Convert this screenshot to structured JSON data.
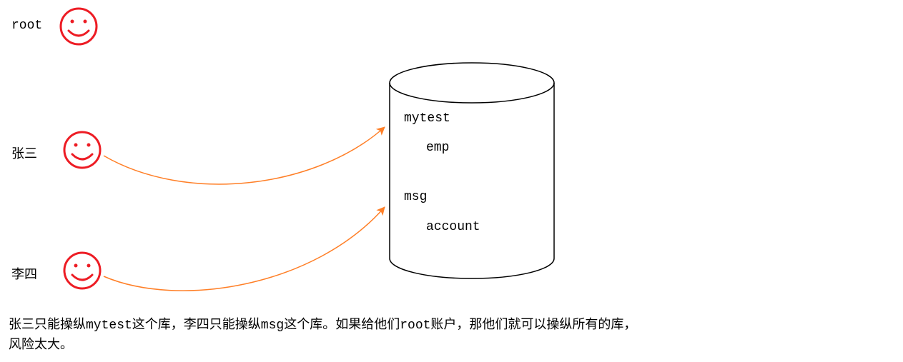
{
  "users": {
    "root": {
      "label": "root"
    },
    "zhangsan": {
      "label": "张三"
    },
    "lisi": {
      "label": "李四"
    }
  },
  "database": {
    "db1": {
      "name": "mytest",
      "table": "emp"
    },
    "db2": {
      "name": "msg",
      "table": "account"
    }
  },
  "footer": {
    "line1": "张三只能操纵mytest这个库，李四只能操纵msg这个库。如果给他们root账户，那他们就可以操纵所有的库，",
    "line2": "风险太大。"
  },
  "colors": {
    "face": "#ED1C24",
    "arrow": "#FF7F27",
    "cylinder": "#000000"
  }
}
